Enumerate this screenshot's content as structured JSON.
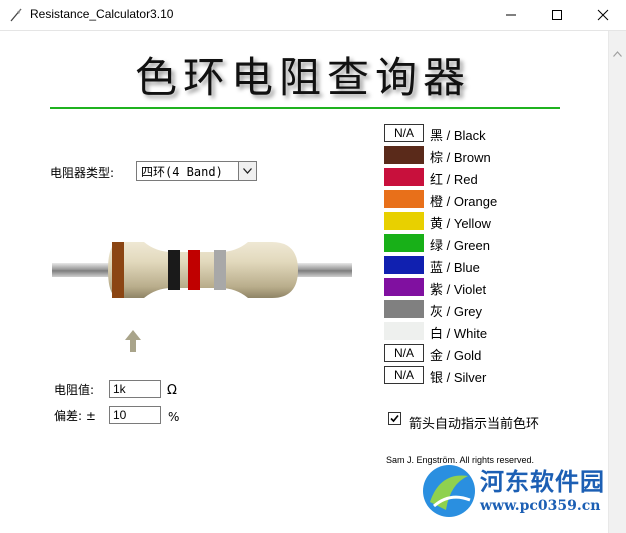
{
  "window": {
    "title": "Resistance_Calculator3.10",
    "minimize_icon": "minimize-icon",
    "maximize_icon": "maximize-icon",
    "close_icon": "close-icon"
  },
  "header": {
    "title": "色环电阻查询器",
    "line_color": "#1fb21f"
  },
  "band_type": {
    "label": "电阻器类型:",
    "selected": "四环(4 Band)"
  },
  "resistor": {
    "band_colors": [
      "#8b4513",
      "#1a1a1a",
      "#c00000",
      "#a8a8a8"
    ]
  },
  "inputs": {
    "resistance_label": "电阻值:",
    "resistance_value": "1k",
    "resistance_unit": "Ω",
    "tolerance_label": "偏差: ±",
    "tolerance_value": "10",
    "tolerance_unit": "%"
  },
  "colors": [
    {
      "swatch": "#ffffff",
      "na_text": "N/A",
      "name": "黑 / Black"
    },
    {
      "swatch": "#5a2a1a",
      "na_text": "",
      "name": "棕 / Brown"
    },
    {
      "swatch": "#c8103c",
      "na_text": "",
      "name": "红 / Red"
    },
    {
      "swatch": "#e8701a",
      "na_text": "",
      "name": "橙 / Orange"
    },
    {
      "swatch": "#e8d000",
      "na_text": "",
      "name": "黄 / Yellow"
    },
    {
      "swatch": "#18b018",
      "na_text": "",
      "name": "绿 / Green"
    },
    {
      "swatch": "#1020b0",
      "na_text": "",
      "name": "蓝 / Blue"
    },
    {
      "swatch": "#8010a0",
      "na_text": "",
      "name": "紫 / Violet"
    },
    {
      "swatch": "#808080",
      "na_text": "",
      "name": "灰 / Grey"
    },
    {
      "swatch": "#eef0ee",
      "na_text": "",
      "name": "白 / White"
    },
    {
      "swatch": "#ffffff",
      "na_text": "N/A",
      "name": "金 / Gold"
    },
    {
      "swatch": "#ffffff",
      "na_text": "N/A",
      "name": "银 / Silver"
    }
  ],
  "auto_arrow": {
    "checked": true,
    "label": "箭头自动指示当前色环"
  },
  "copyright": "Sam J. Engström. All rights reserved.",
  "watermark": {
    "text": "河东软件园",
    "url": "www.pc0359.cn"
  }
}
